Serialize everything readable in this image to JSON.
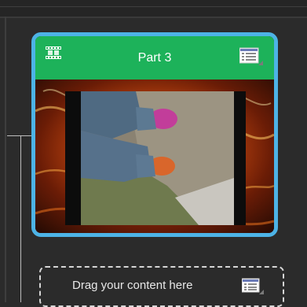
{
  "card": {
    "title": "Part 3",
    "header_color": "#1db25a",
    "border_color": "#4db3e6",
    "left_icon": "film-strip-icon",
    "right_icon": "list-menu-icon"
  },
  "dropzone": {
    "label": "Drag your content here",
    "icon": "list-menu-icon"
  }
}
